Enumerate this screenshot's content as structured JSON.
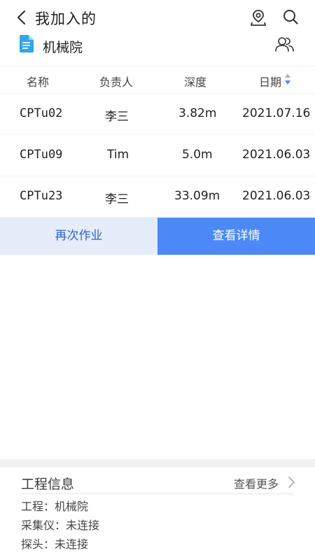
{
  "header": {
    "title": "我加入的",
    "back_icon": "chevron-left-icon",
    "location_icon": "location-pin-icon",
    "search_icon": "search-icon"
  },
  "project": {
    "icon": "document-icon",
    "name": "机械院",
    "members_icon": "members-icon"
  },
  "table": {
    "columns": [
      "名称",
      "负责人",
      "深度",
      "日期"
    ],
    "sort_icon": "sort-updown-icon",
    "rows": [
      {
        "name": "CPTu02",
        "owner": "李三",
        "depth": "3.82m",
        "date": "2021.07.16"
      },
      {
        "name": "CPTu09",
        "owner": "Tim",
        "depth": "5.0m",
        "date": "2021.06.03"
      },
      {
        "name": "CPTu23",
        "owner": "李三",
        "depth": "33.09m",
        "date": "2021.06.03"
      }
    ]
  },
  "actions": {
    "again_label": "再次作业",
    "detail_label": "查看详情"
  },
  "info": {
    "title": "工程信息",
    "more_label": "查看更多",
    "project_line": "工程：机械院",
    "device_line": "采集仪：未连接",
    "probe_line": "探头：未连接"
  },
  "colors": {
    "accent": "#4c89f7",
    "accent_light": "#e5edfa",
    "accent_text": "#2b61c9",
    "doc_icon": "#2ea6e8"
  }
}
